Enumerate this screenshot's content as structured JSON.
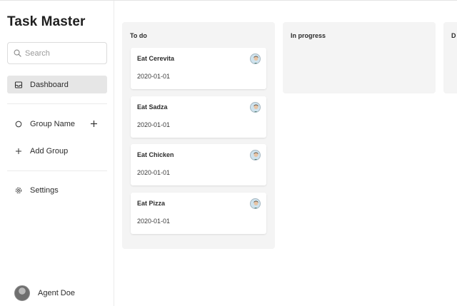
{
  "app": {
    "title": "Task Master"
  },
  "sidebar": {
    "search": {
      "placeholder": "Search",
      "value": "",
      "icon": "search-icon"
    },
    "items": [
      {
        "label": "Dashboard",
        "icon": "inbox-icon",
        "active": true
      },
      {
        "label": "Group Name",
        "icon": "circle-icon"
      },
      {
        "label": "Add Group",
        "icon": "plus-icon"
      },
      {
        "label": "Settings",
        "icon": "gear-icon"
      }
    ],
    "user": {
      "name": "Agent Doe"
    }
  },
  "board": {
    "columns": [
      {
        "title": "To do",
        "cards": [
          {
            "title": "Eat Cerevita",
            "date": "2020-01-01"
          },
          {
            "title": "Eat Sadza",
            "date": "2020-01-01"
          },
          {
            "title": "Eat Chicken",
            "date": "2020-01-01"
          },
          {
            "title": "Eat Pizza",
            "date": "2020-01-01"
          }
        ]
      },
      {
        "title": "In progress",
        "cards": []
      },
      {
        "title": "D",
        "cards": []
      }
    ]
  },
  "colors": {
    "active_nav_bg": "#e6e6e6",
    "column_bg": "#f4f4f4",
    "card_bg": "#ffffff"
  }
}
